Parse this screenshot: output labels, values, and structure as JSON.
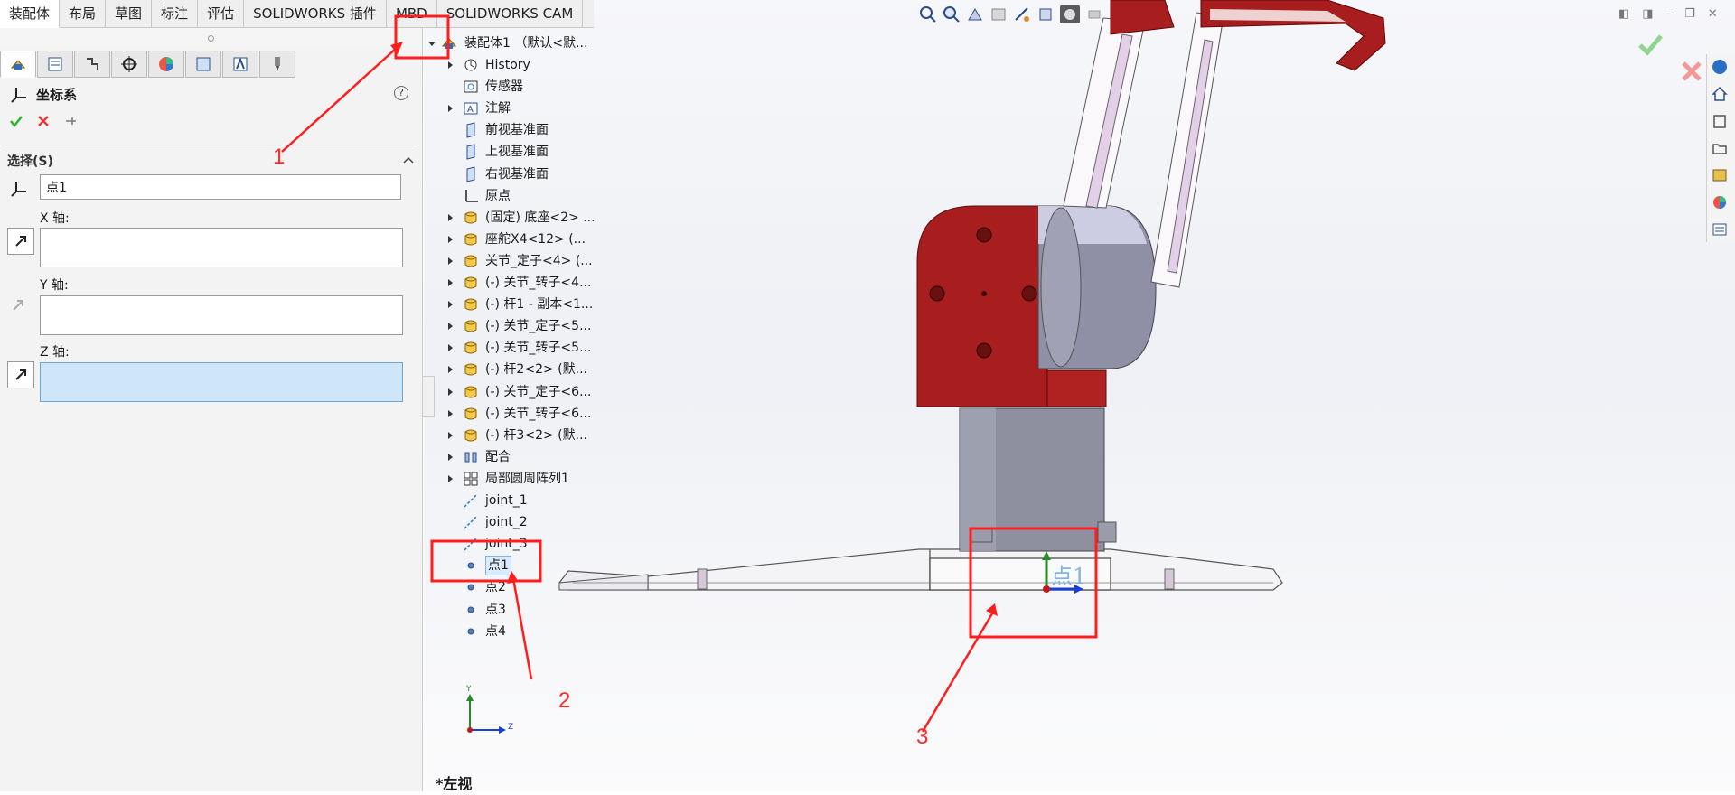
{
  "tabs": [
    "装配体",
    "布局",
    "草图",
    "标注",
    "评估",
    "SOLIDWORKS 插件",
    "MBD",
    "SOLIDWORKS CAM"
  ],
  "property_manager": {
    "title": "坐标系",
    "help": "?",
    "section": "选择(S)",
    "origin_value": "点1",
    "x_label": "X 轴:",
    "y_label": "Y 轴:",
    "z_label": "Z 轴:"
  },
  "tree": {
    "root": "装配体1 （默认<默...",
    "items": [
      {
        "label": "History",
        "icon": "history-icon",
        "expand": true
      },
      {
        "label": "传感器",
        "icon": "sensor-icon",
        "expand": false
      },
      {
        "label": "注解",
        "icon": "annotation-icon",
        "expand": true
      },
      {
        "label": "前视基准面",
        "icon": "plane-icon",
        "expand": false
      },
      {
        "label": "上视基准面",
        "icon": "plane-icon",
        "expand": false
      },
      {
        "label": "右视基准面",
        "icon": "plane-icon",
        "expand": false
      },
      {
        "label": "原点",
        "icon": "origin-icon",
        "expand": false
      },
      {
        "label": "(固定) 底座<2> ...",
        "icon": "part-icon",
        "expand": true
      },
      {
        "label": "座舵X4<12> (...",
        "icon": "part-icon",
        "expand": true
      },
      {
        "label": "关节_定子<4> (...",
        "icon": "part-icon",
        "expand": true
      },
      {
        "label": "(-) 关节_转子<4...",
        "icon": "part-icon",
        "expand": true
      },
      {
        "label": "(-) 杆1 - 副本<1...",
        "icon": "part-icon",
        "expand": true
      },
      {
        "label": "(-) 关节_定子<5...",
        "icon": "part-icon",
        "expand": true
      },
      {
        "label": "(-) 关节_转子<5...",
        "icon": "part-icon",
        "expand": true
      },
      {
        "label": "(-) 杆2<2> (默...",
        "icon": "part-icon",
        "expand": true
      },
      {
        "label": "(-) 关节_定子<6...",
        "icon": "part-icon",
        "expand": true
      },
      {
        "label": "(-) 关节_转子<6...",
        "icon": "part-icon",
        "expand": true
      },
      {
        "label": "(-) 杆3<2> (默...",
        "icon": "part-icon",
        "expand": true
      },
      {
        "label": "配合",
        "icon": "mate-icon",
        "expand": true
      },
      {
        "label": "局部圆周阵列1",
        "icon": "pattern-icon",
        "expand": true
      },
      {
        "label": "joint_1",
        "icon": "axis-icon",
        "expand": false
      },
      {
        "label": "joint_2",
        "icon": "axis-icon",
        "expand": false
      },
      {
        "label": "joint_3",
        "icon": "axis-icon",
        "expand": false
      },
      {
        "label": "点1",
        "icon": "point-icon",
        "expand": false,
        "selected": true
      },
      {
        "label": "点2",
        "icon": "point-icon",
        "expand": false
      },
      {
        "label": "点3",
        "icon": "point-icon",
        "expand": false
      },
      {
        "label": "点4",
        "icon": "point-icon",
        "expand": false
      }
    ]
  },
  "triad": {
    "y": "Y",
    "z": "Z"
  },
  "view_label": "*左视",
  "point_tag": "点1",
  "annotations": {
    "a1": "1",
    "a2": "2",
    "a3": "3"
  },
  "colors": {
    "highlight": "#ff1e1e",
    "model_red": "#a81d1d",
    "model_gray": "#8e90a0",
    "accept": "#2bb32b",
    "reject": "#e23a3a"
  }
}
